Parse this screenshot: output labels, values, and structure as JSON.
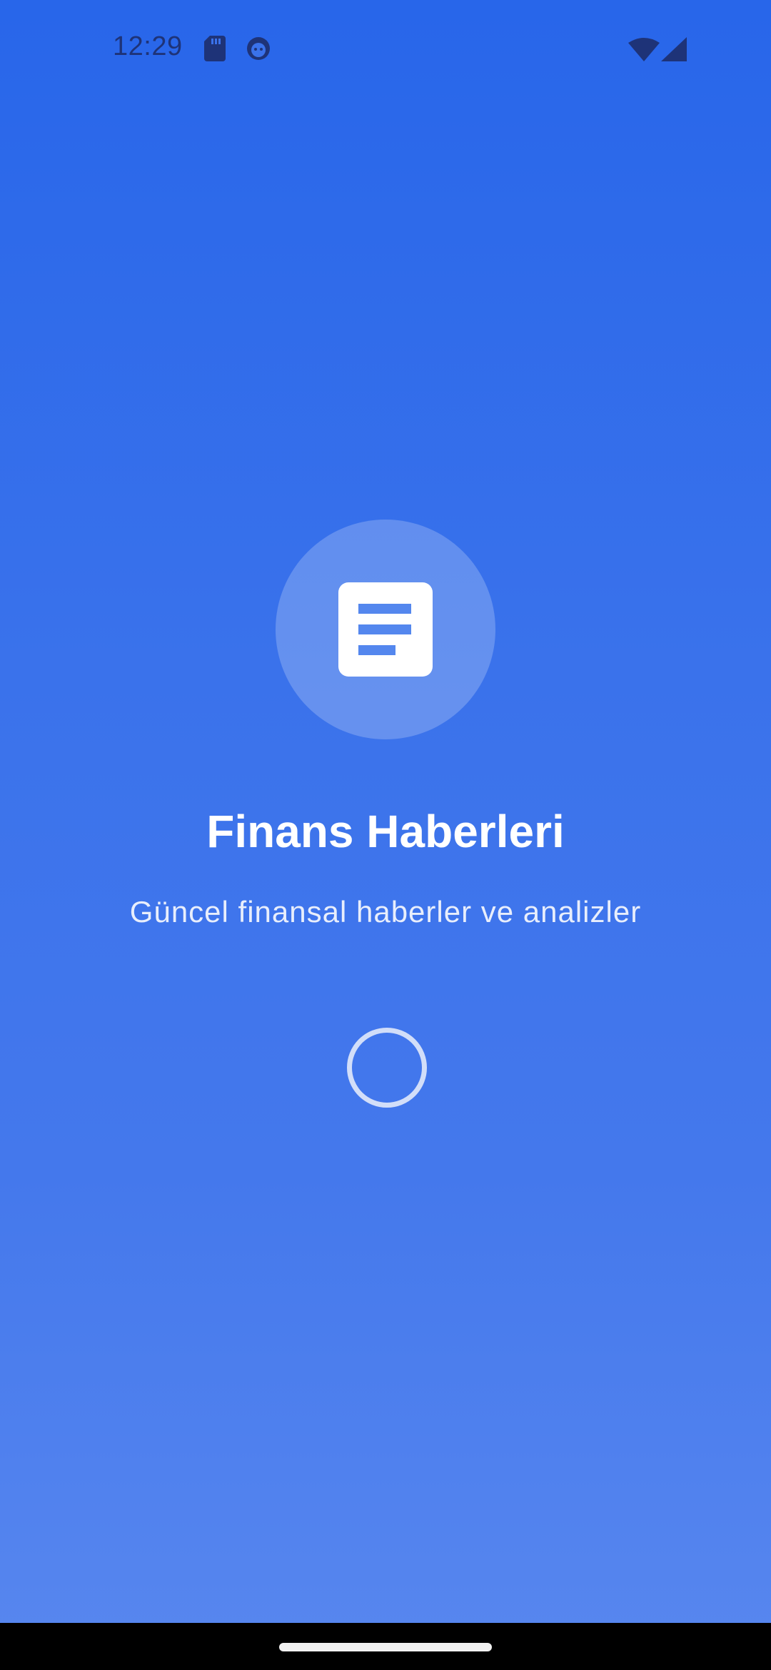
{
  "status_bar": {
    "time": "12:29",
    "icons": [
      "sd-card-icon",
      "face-icon",
      "wifi-icon",
      "signal-icon"
    ]
  },
  "splash": {
    "logo_icon": "document-icon",
    "title": "Finans Haberleri",
    "subtitle": "Güncel finansal haberler ve analizler",
    "loading": true
  },
  "colors": {
    "background_top": "#2866EA",
    "background_bottom": "#5887EF",
    "title": "#FFFFFF",
    "accent": "#5487EE"
  }
}
